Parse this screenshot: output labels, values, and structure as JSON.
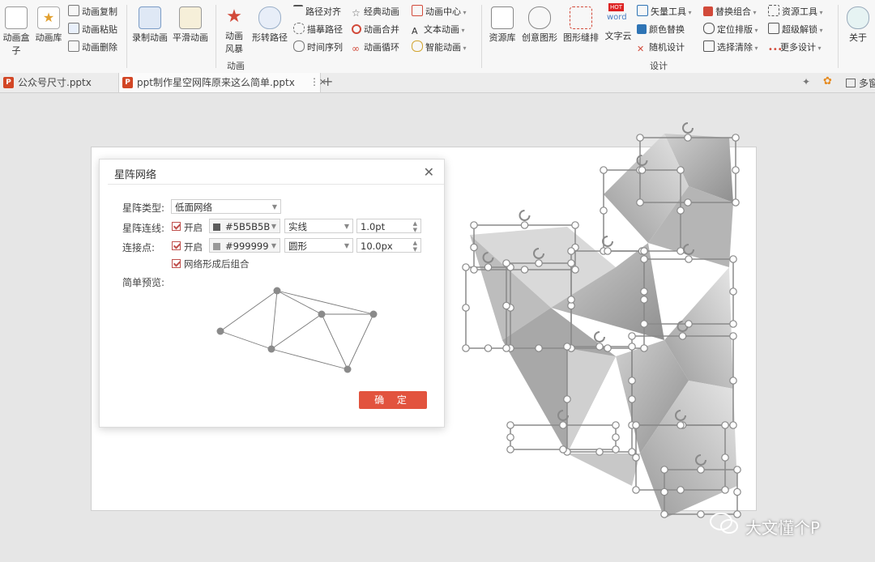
{
  "ribbon": {
    "buttons_large": [
      "动画盒子",
      "动画库",
      "录制动画",
      "平滑动画",
      "动画风暴",
      "形转路径",
      "资源库",
      "创意图形",
      "图形缝排",
      "文字云",
      "关于"
    ],
    "animation_small": [
      "动画复制",
      "动画粘贴",
      "动画删除"
    ],
    "anim_col1": [
      "路径对齐",
      "描摹路径",
      "时间序列"
    ],
    "anim_col2": [
      "经典动画",
      "动画合并",
      "动画循环"
    ],
    "anim_col3": [
      "动画中心",
      "文本动画",
      "智能动画"
    ],
    "design_col1": [
      "矢量工具",
      "颜色替换",
      "随机设计"
    ],
    "design_col2": [
      "替换组合",
      "定位排版",
      "选择清除"
    ],
    "design_col3": [
      "资源工具",
      "超级解锁",
      "更多设计"
    ],
    "group_animation": "动画",
    "group_design": "设计",
    "hot_badge": "HOT",
    "word_badge": "word"
  },
  "tabs": {
    "tab1": "公众号尺寸.pptx",
    "tab2": "ppt制作星空网阵原来这么简单.pptx",
    "close": "✕",
    "more": "⋮",
    "add": "+",
    "window_label": "多窗"
  },
  "dialog": {
    "title": "星阵网络",
    "close": "✕",
    "type_label": "星阵类型:",
    "type_value": "低面网络",
    "line_label": "星阵连线:",
    "line_enabled": "开启",
    "line_color": "#5B5B5B",
    "line_style": "实线",
    "line_width": "1.0pt",
    "point_label": "连接点:",
    "point_enabled": "开启",
    "point_color": "#999999",
    "point_shape": "圆形",
    "point_size": "10.0px",
    "group_label": "网络形成后组合",
    "preview_label": "简单预览:",
    "ok": "确 定"
  },
  "watermark": "大文懂个P",
  "colors": {
    "accent": "#e2533e",
    "line_swatch": "#5B5B5B",
    "point_swatch": "#999999"
  }
}
